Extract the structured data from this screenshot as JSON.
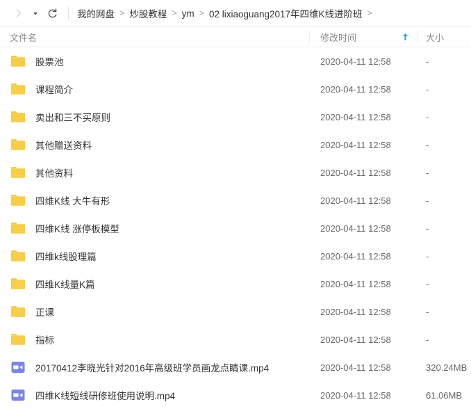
{
  "toolbar": {
    "forward_icon": "chevron-right-icon",
    "dropdown_icon": "caret-down-icon",
    "refresh_icon": "refresh-icon",
    "accent_color": "#2aa1f0"
  },
  "breadcrumb": {
    "separator": ">",
    "items": [
      {
        "label": "我的网盘"
      },
      {
        "label": "炒股教程"
      },
      {
        "label": "ym"
      },
      {
        "label": "02 lixiaoguang2017年四维K线进阶班"
      }
    ],
    "trailing_separator": ">"
  },
  "columns": {
    "name": "文件名",
    "time": "修改时间",
    "size": "大小",
    "sort": {
      "column": "修改时间",
      "direction": "asc",
      "glyph": "arrow-up-icon",
      "color": "#2aa1f0"
    }
  },
  "colors": {
    "folder": "#f7ce46",
    "folder_tab": "#f0c32e",
    "video": "#7b83eb",
    "text": "#333333",
    "muted": "#666666",
    "header_text": "#8a8a8a",
    "border": "#ededed"
  },
  "rows": [
    {
      "type": "folder",
      "icon": "folder-icon",
      "name": "股票池",
      "modified": "2020-04-11 12:58",
      "size": "-"
    },
    {
      "type": "folder",
      "icon": "folder-icon",
      "name": "课程简介",
      "modified": "2020-04-11 12:58",
      "size": "-"
    },
    {
      "type": "folder",
      "icon": "folder-icon",
      "name": "卖出和三不买原则",
      "modified": "2020-04-11 12:58",
      "size": "-"
    },
    {
      "type": "folder",
      "icon": "folder-icon",
      "name": "其他赠送资料",
      "modified": "2020-04-11 12:58",
      "size": "-"
    },
    {
      "type": "folder",
      "icon": "folder-icon",
      "name": "其他资料",
      "modified": "2020-04-11 12:58",
      "size": "-"
    },
    {
      "type": "folder",
      "icon": "folder-icon",
      "name": "四维K线 大牛有形",
      "modified": "2020-04-11 12:58",
      "size": "-"
    },
    {
      "type": "folder",
      "icon": "folder-icon",
      "name": "四维K线 涨停板模型",
      "modified": "2020-04-11 12:58",
      "size": "-"
    },
    {
      "type": "folder",
      "icon": "folder-icon",
      "name": "四维k线股理篇",
      "modified": "2020-04-11 12:58",
      "size": "-"
    },
    {
      "type": "folder",
      "icon": "folder-icon",
      "name": "四维K线量K篇",
      "modified": "2020-04-11 12:58",
      "size": "-"
    },
    {
      "type": "folder",
      "icon": "folder-icon",
      "name": "正课",
      "modified": "2020-04-11 12:58",
      "size": "-"
    },
    {
      "type": "folder",
      "icon": "folder-icon",
      "name": "指标",
      "modified": "2020-04-11 12:58",
      "size": "-"
    },
    {
      "type": "video",
      "icon": "video-file-icon",
      "name": "20170412李晓光针对2016年高级班学员画龙点睛课.mp4",
      "modified": "2020-04-11 12:58",
      "size": "320.24MB"
    },
    {
      "type": "video",
      "icon": "video-file-icon",
      "name": "四维K线短线研修班使用说明.mp4",
      "modified": "2020-04-11 12:58",
      "size": "61.06MB"
    }
  ]
}
